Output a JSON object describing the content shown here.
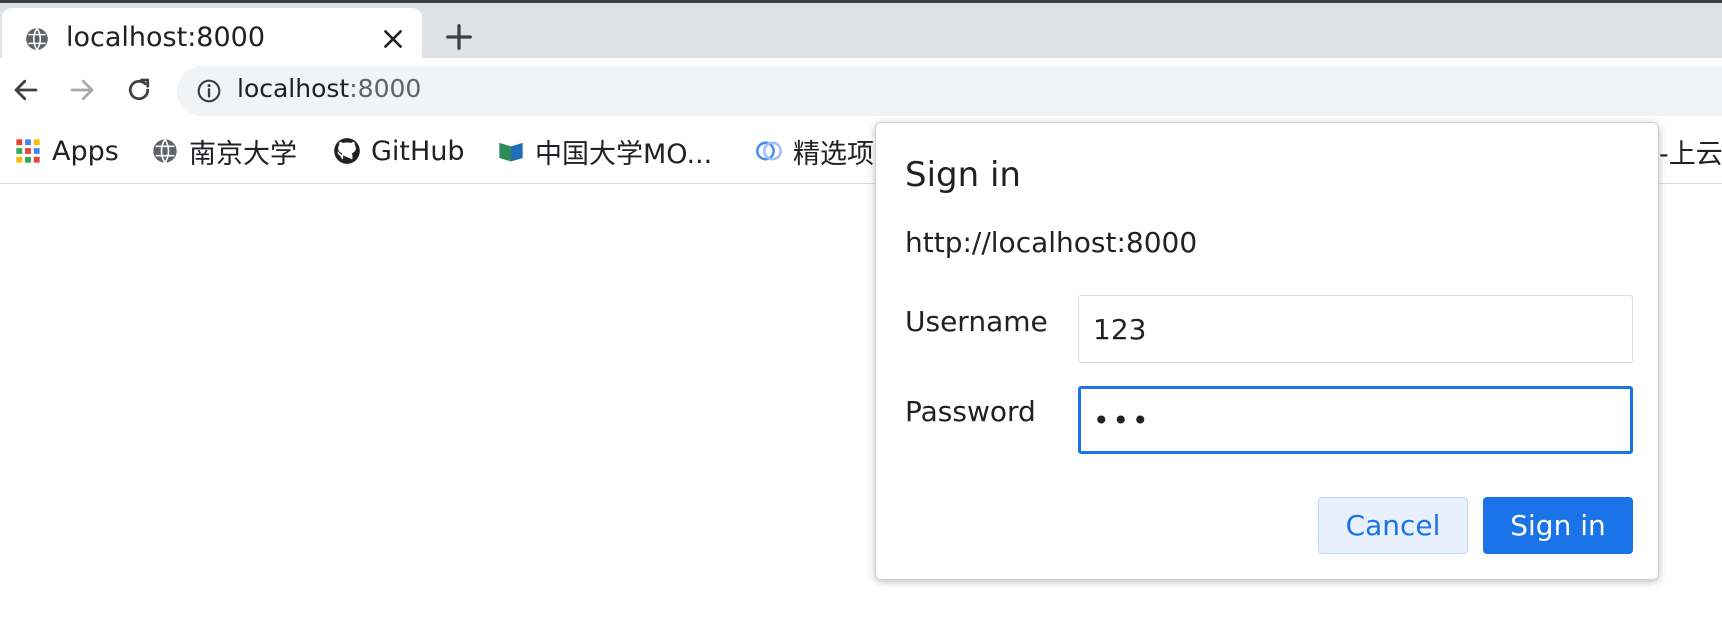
{
  "tab": {
    "title": "localhost:8000",
    "favicon": "globe-icon",
    "close_icon": "close-icon",
    "new_tab_icon": "plus-icon"
  },
  "toolbar": {
    "back_icon": "arrow-left-icon",
    "forward_icon": "arrow-right-icon",
    "reload_icon": "reload-icon",
    "site_info_icon": "info-icon",
    "url_host": "localhost",
    "url_port": ":8000"
  },
  "bookmarks": [
    {
      "label": "Apps",
      "icon": "apps-grid-icon"
    },
    {
      "label": "南京大学",
      "icon": "globe-icon"
    },
    {
      "label": "GitHub",
      "icon": "github-icon"
    },
    {
      "label": "中国大学MO...",
      "icon": "mooc-icon"
    },
    {
      "label": "精选项",
      "icon": "clouds-icon"
    },
    {
      "label": "云-上云",
      "icon": ""
    }
  ],
  "dialog": {
    "title": "Sign in",
    "origin": "http://localhost:8000",
    "username_label": "Username",
    "username_value": "123",
    "password_label": "Password",
    "password_value": "•••",
    "cancel_label": "Cancel",
    "submit_label": "Sign in"
  },
  "colors": {
    "accent": "#1a73e8",
    "tabstrip_bg": "#dee1e6",
    "omnibox_bg": "#f1f3f4"
  }
}
